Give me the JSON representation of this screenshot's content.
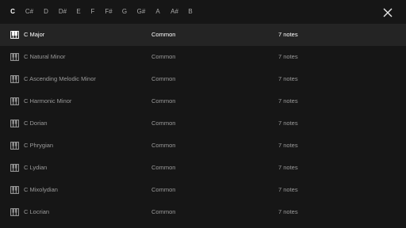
{
  "keys": [
    "C",
    "C#",
    "D",
    "D#",
    "E",
    "F",
    "F#",
    "G",
    "G#",
    "A",
    "A#",
    "B"
  ],
  "selected_key": "C",
  "close_icon": "close-icon",
  "row_icon": "piano-keys-icon",
  "selected_row": 0,
  "scales": [
    {
      "name": "C Major",
      "category": "Common",
      "notes": "7 notes"
    },
    {
      "name": "C Natural Minor",
      "category": "Common",
      "notes": "7 notes"
    },
    {
      "name": "C Ascending Melodic Minor",
      "category": "Common",
      "notes": "7 notes"
    },
    {
      "name": "C Harmonic Minor",
      "category": "Common",
      "notes": "7 notes"
    },
    {
      "name": "C Dorian",
      "category": "Common",
      "notes": "7 notes"
    },
    {
      "name": "C Phrygian",
      "category": "Common",
      "notes": "7 notes"
    },
    {
      "name": "C Lydian",
      "category": "Common",
      "notes": "7 notes"
    },
    {
      "name": "C Mixolydian",
      "category": "Common",
      "notes": "7 notes"
    },
    {
      "name": "C Locrian",
      "category": "Common",
      "notes": "7 notes"
    }
  ],
  "colors": {
    "background": "#161616",
    "selected_row": "#242424",
    "text_active": "#ffffff",
    "text_muted": "#9a9a9a"
  }
}
